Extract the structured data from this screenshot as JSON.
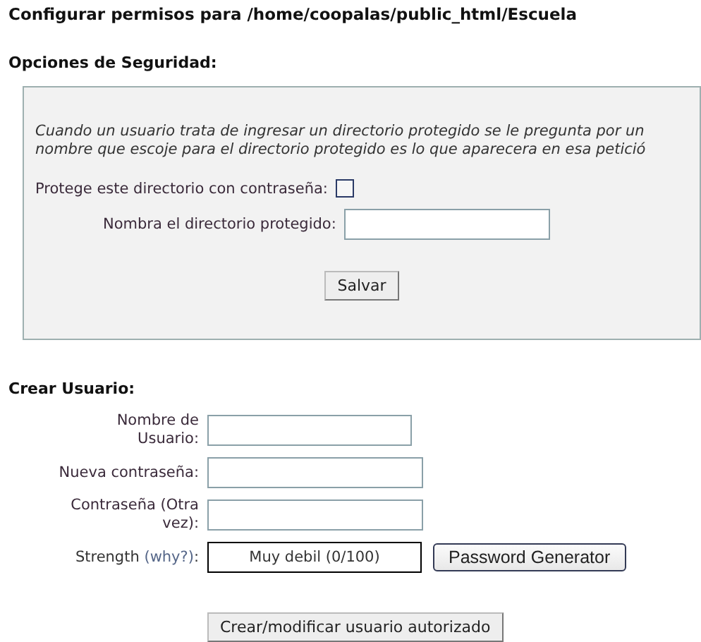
{
  "title": "Configurar permisos para /home/coopalas/public_html/Escuela",
  "security": {
    "heading": "Opciones de Seguridad:",
    "description": [
      "Cuando un usuario trata de ingresar un directorio protegido se le pregunta por un",
      "nombre que escoje para el directorio protegido es lo que aparecera en esa petició"
    ],
    "protect": {
      "label": "Protege este directorio con contraseña:",
      "checked": false
    },
    "name_field": {
      "label": "Nombra el directorio protegido:"
    },
    "save_button": "Salvar"
  },
  "user": {
    "heading": "Crear Usuario:",
    "fields": [
      {
        "label": "Nombre de Usuario:",
        "wide": false
      },
      {
        "label": "Nueva contraseña:",
        "wide": true
      },
      {
        "label": "Contraseña (Otra vez):",
        "wide": true
      }
    ],
    "strength": {
      "label": "Strength",
      "link": "(why?)",
      "suffix": ":",
      "value": "Muy debil (0/100)"
    },
    "generator_button": "Password Generator",
    "submit_button": "Crear/modificar usuario autorizado"
  }
}
